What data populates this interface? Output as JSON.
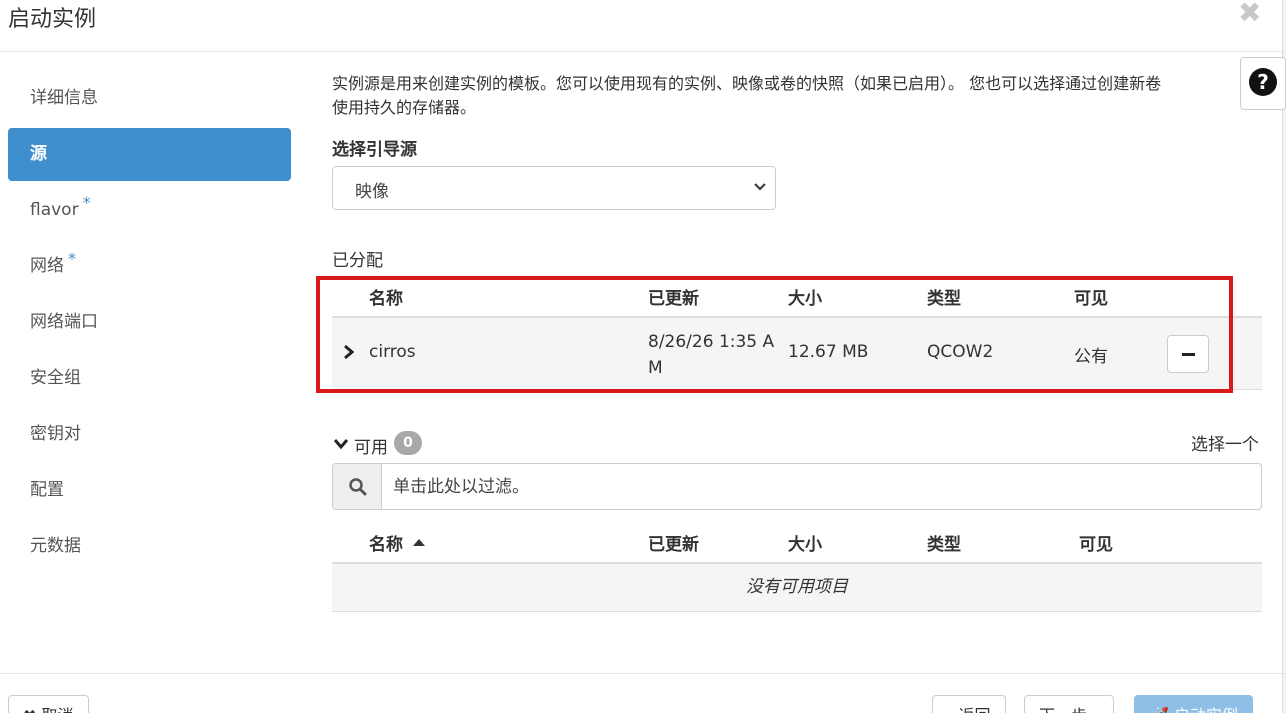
{
  "modal": {
    "title": "启动实例",
    "close_symbol": "✖"
  },
  "sidebar": {
    "items": [
      {
        "label": "详细信息",
        "required": false,
        "active": false
      },
      {
        "label": "源",
        "required": false,
        "active": true
      },
      {
        "label": "flavor",
        "required": true,
        "active": false
      },
      {
        "label": "网络",
        "required": true,
        "active": false
      },
      {
        "label": "网络端口",
        "required": false,
        "active": false
      },
      {
        "label": "安全组",
        "required": false,
        "active": false
      },
      {
        "label": "密钥对",
        "required": false,
        "active": false
      },
      {
        "label": "配置",
        "required": false,
        "active": false
      },
      {
        "label": "元数据",
        "required": false,
        "active": false
      }
    ],
    "required_mark": "*"
  },
  "source": {
    "description_line1": "实例源是用来创建实例的模板。您可以使用现有的实例、映像或卷的快照（如果已启用）。 您也可以选择通过创建新卷",
    "description_line2": "使用持久的存储器。",
    "help_symbol": "?",
    "boot_source_label": "选择引导源",
    "boot_source_value": "映像",
    "allocated_label": "已分配",
    "columns": {
      "name": "名称",
      "updated": "已更新",
      "size": "大小",
      "type": "类型",
      "visibility": "可见"
    },
    "allocated_rows": [
      {
        "name": "cirros",
        "updated_line1": "8/26/26 1:35 A",
        "updated_line2": "M",
        "size": "12.67 MB",
        "type": "QCOW2",
        "visibility": "公有"
      }
    ],
    "available": {
      "label": "可用",
      "count": "0",
      "select_one": "选择一个",
      "filter_placeholder": "单击此处以过滤。",
      "empty_message": "没有可用项目"
    }
  },
  "footer": {
    "cancel": "✖ 取消",
    "back": "‹ 返回",
    "next": "下一步 ›",
    "launch": "🚀 启动实例"
  },
  "colors": {
    "accent": "#3f8fcf",
    "highlight": "#d9191a",
    "badge": "#a8a8a8"
  },
  "icons": {
    "close": "close-icon",
    "help": "question-circle-icon",
    "chevron": "chevron-down-icon",
    "expand": "chevron-right-icon",
    "remove": "minus-icon",
    "search": "search-icon"
  }
}
